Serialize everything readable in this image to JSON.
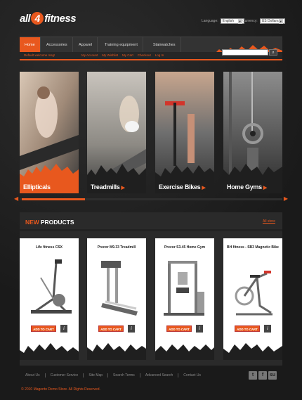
{
  "logo": {
    "part1": "all",
    "part2": "4",
    "part3": "fitness"
  },
  "header": {
    "language_label": "Language:",
    "language_value": "English",
    "currency_label": "Currency:",
    "currency_value": "US Dollars"
  },
  "nav": {
    "items": [
      "Home",
      "Accessories",
      "Apparel",
      "Training equipment",
      "Stairwatches"
    ],
    "active_index": 0
  },
  "subbar": {
    "welcome": "Default welcome msg!",
    "links": [
      "My Account",
      "My Wishlist",
      "My Cart",
      "Checkout",
      "Log In"
    ]
  },
  "search": {
    "placeholder": "",
    "button_icon": "search-icon"
  },
  "banners": [
    {
      "label": "Ellipticals",
      "highlight": true
    },
    {
      "label": "Treadmills",
      "highlight": false
    },
    {
      "label": "Exercise Bikes",
      "highlight": false
    },
    {
      "label": "Home Gyms",
      "highlight": false
    }
  ],
  "slider": {
    "progress": 0.24
  },
  "new_products": {
    "title_new": "NEW",
    "title_rest": "PRODUCTS",
    "all_link": "All store",
    "items": [
      {
        "name": "Life fitness CSX",
        "cart_label": "ADD TO CART"
      },
      {
        "name": "Precor M9.33 Treadmill",
        "cart_label": "ADD TO CART"
      },
      {
        "name": "Precor S3.45 Home Gym",
        "cart_label": "ADD TO CART"
      },
      {
        "name": "BH fitness - SB3 Magnetic Bike",
        "cart_label": "ADD TO CART"
      }
    ]
  },
  "footer": {
    "links": [
      "About Us",
      "Customer Service",
      "Site Map",
      "Search Terms",
      "Advanced Search",
      "Contact Us"
    ],
    "social": [
      "t",
      "f",
      "su"
    ],
    "copyright": "© 2010 Magento Demo Store. All Rights Reserved."
  },
  "colors": {
    "accent": "#e8581e",
    "background": "#1f1f1f",
    "panel": "#2a2a2a"
  }
}
